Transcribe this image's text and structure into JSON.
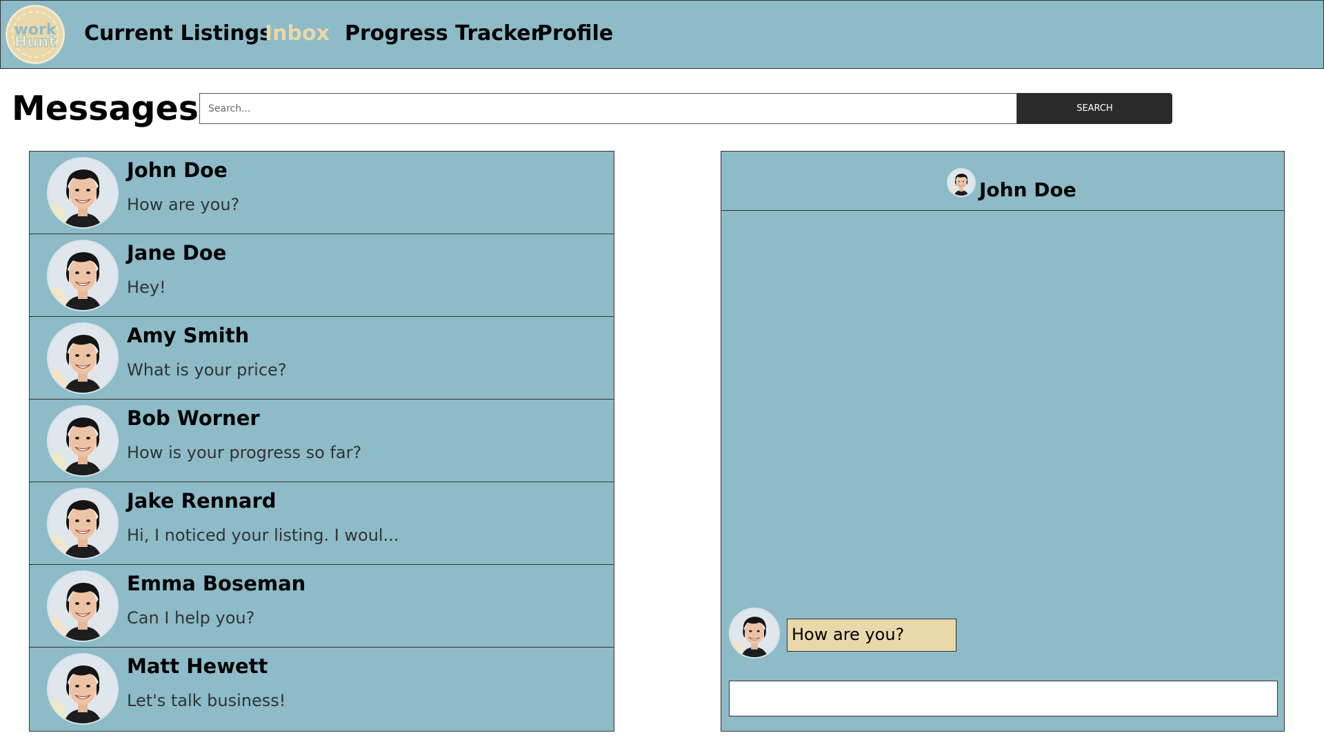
{
  "app": {
    "logo_text_top": "work",
    "logo_text_bottom": "Hunt"
  },
  "nav": {
    "items": [
      {
        "label": "Current Listings",
        "active": false
      },
      {
        "label": "Inbox",
        "active": true
      },
      {
        "label": "Progress Tracker",
        "active": false
      },
      {
        "label": "Profile",
        "active": false
      }
    ]
  },
  "page": {
    "title": "Messages"
  },
  "search": {
    "placeholder": "Search...",
    "value": "",
    "button_label": "SEARCH"
  },
  "conversations": [
    {
      "name": "John Doe",
      "preview": "How are you?"
    },
    {
      "name": "Jane Doe",
      "preview": "Hey!"
    },
    {
      "name": "Amy Smith",
      "preview": "What is your price?"
    },
    {
      "name": "Bob Worner",
      "preview": "How is your progress so far?"
    },
    {
      "name": "Jake Rennard",
      "preview": "Hi, I noticed your listing. I woul..."
    },
    {
      "name": "Emma Boseman",
      "preview": "Can I help you?"
    },
    {
      "name": "Matt Hewett",
      "preview": "Let's talk business!"
    }
  ],
  "chat": {
    "contact_name": "John Doe",
    "messages": [
      {
        "text": "How are you?"
      }
    ],
    "input_value": ""
  },
  "colors": {
    "panel": "#8dbbc8",
    "accent": "#e8d8aa",
    "button": "#2a2a2a"
  },
  "icons": {
    "avatar": "person-photo-avatar",
    "logo": "workhunt-logo"
  }
}
